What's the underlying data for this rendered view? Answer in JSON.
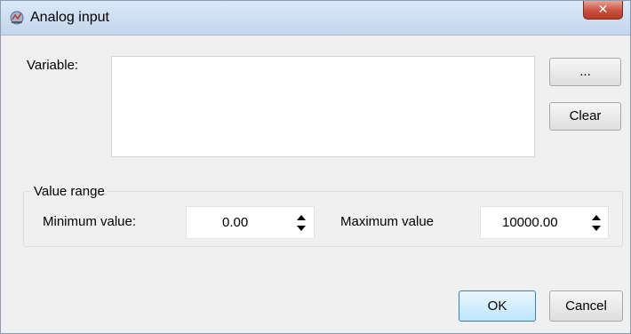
{
  "window": {
    "title": "Analog input",
    "close_label": "✕"
  },
  "variable": {
    "label": "Variable:",
    "value": "",
    "browse_label": "...",
    "clear_label": "Clear"
  },
  "value_range": {
    "group_label": "Value range",
    "min_label": "Minimum value:",
    "min_value": "0.00",
    "max_label": "Maximum value",
    "max_value": "10000.00"
  },
  "buttons": {
    "ok_label": "OK",
    "cancel_label": "Cancel"
  },
  "icons": {
    "app": "analog-input-app-icon",
    "close": "close-icon",
    "spin": "up-down-arrows-icon"
  }
}
